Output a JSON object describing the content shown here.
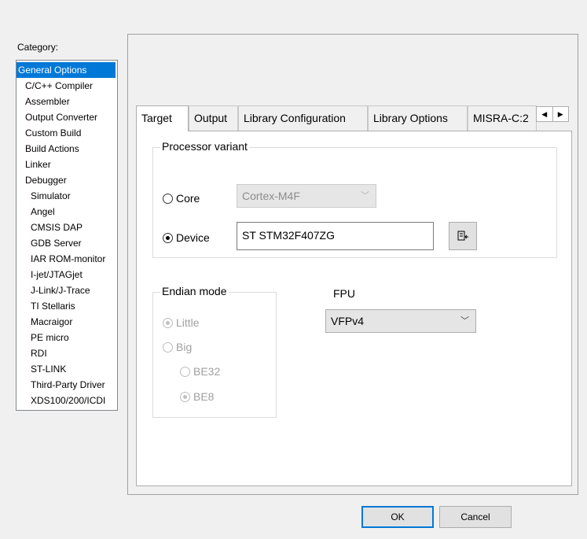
{
  "category": {
    "label": "Category:",
    "items": [
      {
        "label": "General Options",
        "level": 0,
        "selected": true
      },
      {
        "label": "C/C++ Compiler",
        "level": 1
      },
      {
        "label": "Assembler",
        "level": 1
      },
      {
        "label": "Output Converter",
        "level": 1
      },
      {
        "label": "Custom Build",
        "level": 1
      },
      {
        "label": "Build Actions",
        "level": 1
      },
      {
        "label": "Linker",
        "level": 1
      },
      {
        "label": "Debugger",
        "level": 1
      },
      {
        "label": "Simulator",
        "level": 2
      },
      {
        "label": "Angel",
        "level": 2
      },
      {
        "label": "CMSIS DAP",
        "level": 2
      },
      {
        "label": "GDB Server",
        "level": 2
      },
      {
        "label": "IAR ROM-monitor",
        "level": 2
      },
      {
        "label": "I-jet/JTAGjet",
        "level": 2
      },
      {
        "label": "J-Link/J-Trace",
        "level": 2
      },
      {
        "label": "TI Stellaris",
        "level": 2
      },
      {
        "label": "Macraigor",
        "level": 2
      },
      {
        "label": "PE micro",
        "level": 2
      },
      {
        "label": "RDI",
        "level": 2
      },
      {
        "label": "ST-LINK",
        "level": 2
      },
      {
        "label": "Third-Party Driver",
        "level": 2
      },
      {
        "label": "XDS100/200/ICDI",
        "level": 2
      }
    ]
  },
  "tabs": [
    {
      "label": "Target",
      "active": true
    },
    {
      "label": "Output"
    },
    {
      "label": "Library Configuration"
    },
    {
      "label": "Library Options"
    },
    {
      "label": "MISRA-C:2"
    }
  ],
  "tab_scroll": {
    "left_icon": "scroll-left-icon",
    "right_icon": "scroll-right-icon"
  },
  "processor": {
    "title": "Processor variant",
    "core_label": "Core",
    "core_value": "Cortex-M4F",
    "device_label": "Device",
    "device_value": "ST STM32F407ZG",
    "selected": "device",
    "browse_icon": "device-select-icon"
  },
  "endian": {
    "title": "Endian mode",
    "little_label": "Little",
    "big_label": "Big",
    "be32_label": "BE32",
    "be8_label": "BE8",
    "selected": "little",
    "big_selected": "be8"
  },
  "fpu": {
    "label": "FPU",
    "value": "VFPv4"
  },
  "buttons": {
    "ok": "OK",
    "cancel": "Cancel"
  },
  "colors": {
    "selection": "#0078d7",
    "dialog_bg": "#f0f0f0"
  }
}
